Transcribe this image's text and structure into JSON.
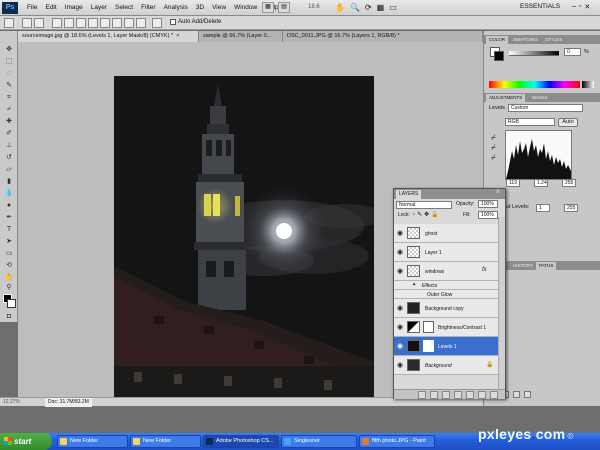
{
  "app": {
    "logo": "Ps",
    "menus": [
      "File",
      "Edit",
      "Image",
      "Layer",
      "Select",
      "Filter",
      "Analysis",
      "3D",
      "View",
      "Window",
      "Help"
    ],
    "zoom": "18.6",
    "workspace": "ESSENTIALS"
  },
  "options": {
    "auto_add_delete": "Auto Add/Delete"
  },
  "doc_tabs": [
    {
      "label": "sourceimage.jpg @ 18.6% (Levels 1, Layer Mask/8) (CMYK) *",
      "active": true
    },
    {
      "label": "sample @ 66.7% (Layer 0...",
      "active": false
    },
    {
      "label": "DSC_0011.JPG @ 16.7% (Layers 1, RGB/8) *",
      "active": false
    }
  ],
  "status": {
    "zoom": "12.27%",
    "doc_size": "Doc: 31.7M/83.2M"
  },
  "color_panel": {
    "tabs": [
      "COLOR",
      "SWATCHES",
      "STYLES"
    ],
    "value": "0",
    "unit": "%"
  },
  "adjustments": {
    "tabs": [
      "ADJUSTMENTS",
      "MASKS"
    ],
    "title": "Levels",
    "preset": "Custom",
    "channel": "RGB",
    "auto": "Auto",
    "input_black": "119",
    "input_gamma": "1.24",
    "input_white": "255",
    "output_label": "Output Levels:",
    "output_black": "1",
    "output_white": "255"
  },
  "side_tabs": [
    "HISTORY",
    "PATHS"
  ],
  "layers_panel": {
    "tab": "LAYERS",
    "blend_mode": "Normal",
    "opacity_label": "Opacity:",
    "opacity": "100%",
    "lock_label": "Lock:",
    "fill_label": "Fill:",
    "fill": "100%",
    "layers": [
      {
        "name": "ghost",
        "type": "pixel",
        "selected": false,
        "visible": true
      },
      {
        "name": "Layer 1",
        "type": "pixel",
        "selected": false,
        "visible": true
      },
      {
        "name": "windows",
        "type": "pixel",
        "selected": false,
        "visible": true,
        "fx": "fx"
      },
      {
        "name": "Effects",
        "type": "effect",
        "selected": false,
        "visible": true
      },
      {
        "name": "Outer Glow",
        "type": "effect",
        "selected": false,
        "visible": true
      },
      {
        "name": "Background copy",
        "type": "image",
        "selected": false,
        "visible": true
      },
      {
        "name": "Brightness/Contrast 1",
        "type": "adjustment",
        "selected": false,
        "visible": true
      },
      {
        "name": "Levels 1",
        "type": "adjustment",
        "selected": true,
        "visible": true
      },
      {
        "name": "Background",
        "type": "image",
        "selected": false,
        "visible": true,
        "locked": true
      }
    ]
  },
  "taskbar": {
    "start": "start",
    "items": [
      {
        "label": "New Folder",
        "active": false
      },
      {
        "label": "New Folder",
        "active": false
      },
      {
        "label": "Adobe Photoshop CS...",
        "active": true
      },
      {
        "label": "Singlesnet",
        "active": false
      },
      {
        "label": "fifth photo.JPG - Paint",
        "active": false
      }
    ]
  },
  "watermark": {
    "pre": "pxl",
    "mid": "eyes",
    "dot": ".",
    "com": "com",
    "copy": "©"
  }
}
